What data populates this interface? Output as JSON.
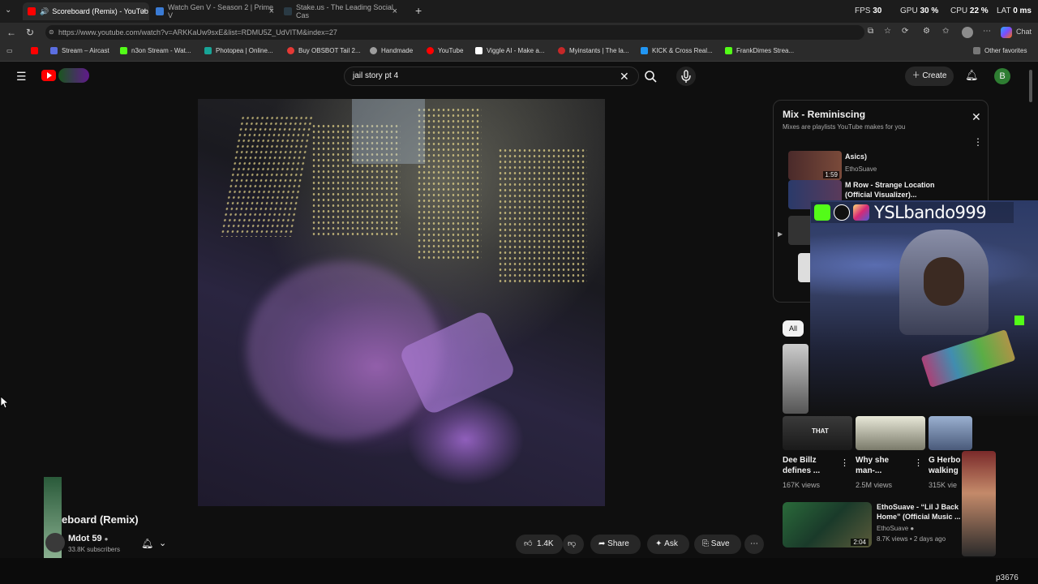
{
  "browser": {
    "tabs": [
      {
        "label": "Scoreboard (Remix) - YouTub",
        "color": "#ff0000"
      },
      {
        "label": "Watch Gen V - Season 2 | Prime V",
        "color": "#3a7bd5"
      },
      {
        "label": "Stake.us - The Leading Social Cas",
        "color": "#2a3a44"
      }
    ],
    "new_tab": "+",
    "stats": {
      "fps_label": "FPS",
      "fps": "30",
      "gpu_label": "GPU",
      "gpu": "30 %",
      "cpu_label": "CPU",
      "cpu": "22 %",
      "lat_label": "LAT",
      "lat": "0 ms"
    },
    "url": "https://www.youtube.com/watch?v=ARKKaUw9sxE&list=RDMU5Z_UdVITM&index=27",
    "chat_label": "Chat",
    "bookmarks": [
      {
        "label": "Stream – Aircast",
        "color": "#5b6ee1"
      },
      {
        "label": "n3on Stream - Wat...",
        "color": "#53fc18"
      },
      {
        "label": "Photopea | Online...",
        "color": "#18a497"
      },
      {
        "label": "Buy OBSBOT Tail 2...",
        "color": "#e53935"
      },
      {
        "label": "Handmade",
        "color": "#9e9e9e"
      },
      {
        "label": "YouTube",
        "color": "#ff0000"
      },
      {
        "label": "Viggle AI - Make a...",
        "color": "#ffffff"
      },
      {
        "label": "Myinstants | The la...",
        "color": "#c62828"
      },
      {
        "label": "KICK & Cross Real...",
        "color": "#2196f3"
      },
      {
        "label": "FrankDimes Strea...",
        "color": "#53fc18"
      }
    ],
    "other_favorites": "Other favorites"
  },
  "youtube": {
    "search_query": "jail story pt 4",
    "create_label": "Create",
    "avatar_letter": "B",
    "video": {
      "title": "eboard (Remix)",
      "channel": "Mdot 59",
      "subscribers": "33.8K subscribers",
      "likes": "1.4K",
      "share": "Share",
      "ask": "Ask",
      "save": "Save"
    },
    "mix": {
      "title": "Mix - Reminiscing",
      "subtitle": "Mixes are playlists YouTube makes for you",
      "items": [
        {
          "title": "Asics)",
          "channel": "EthoSuave",
          "duration": "1:59"
        },
        {
          "title": "M Row - Strange Location (Official Visualizer)...",
          "channel": ""
        }
      ]
    },
    "chip_all": "All",
    "shorts": [
      {
        "title": "Dee Billz defines ...",
        "views": "167K views"
      },
      {
        "title": "Why she man-...",
        "views": "2.5M views"
      },
      {
        "title": "G Herbo walking",
        "views": "315K vie"
      }
    ],
    "recommendation": {
      "title": "EthoSuave - “Lil J Back Home” (Official Music ...",
      "channel": "EthoSuave",
      "meta": "8.7K views • 2 days ago",
      "duration": "2:04"
    }
  },
  "overlay": {
    "handle": "YSLbando999",
    "short_caption": "THAT",
    "watermark": "p3676"
  }
}
